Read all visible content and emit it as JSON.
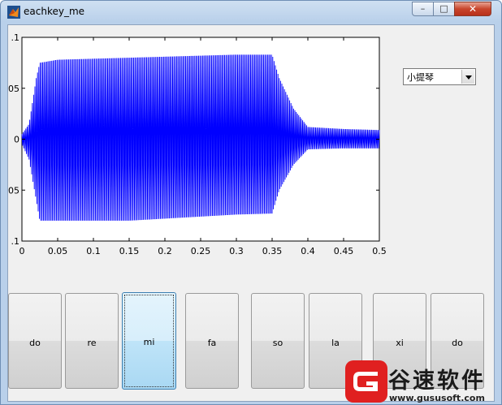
{
  "window": {
    "title": "eachkey_me",
    "min_label": "–",
    "max_label": "□",
    "close_label": "✕"
  },
  "axes": {
    "yticks": [
      {
        "value": 0.1,
        "label": ".1"
      },
      {
        "value": 0.05,
        "label": ".05"
      },
      {
        "value": 0,
        "label": "0"
      },
      {
        "value": -0.05,
        "label": ".05"
      },
      {
        "value": -0.1,
        "label": ".1"
      }
    ],
    "xticks": [
      {
        "value": 0,
        "label": "0"
      },
      {
        "value": 0.05,
        "label": "0.05"
      },
      {
        "value": 0.1,
        "label": "0.1"
      },
      {
        "value": 0.15,
        "label": "0.15"
      },
      {
        "value": 0.2,
        "label": "0.2"
      },
      {
        "value": 0.25,
        "label": "0.25"
      },
      {
        "value": 0.3,
        "label": "0.3"
      },
      {
        "value": 0.35,
        "label": "0.35"
      },
      {
        "value": 0.4,
        "label": "0.4"
      },
      {
        "value": 0.45,
        "label": "0.45"
      },
      {
        "value": 0.5,
        "label": "0.5"
      }
    ],
    "xlim": [
      0,
      0.5
    ],
    "ylim": [
      -0.1,
      0.1
    ],
    "line_color": "#0000ff"
  },
  "chart_data": {
    "type": "line",
    "title": "",
    "xlabel": "",
    "ylabel": "",
    "xlim": [
      0,
      0.5
    ],
    "ylim": [
      -0.1,
      0.1
    ],
    "grid": false,
    "series": [
      {
        "color": "#0000ff",
        "envelope_x": [
          0,
          0.01,
          0.02,
          0.025,
          0.05,
          0.1,
          0.15,
          0.2,
          0.25,
          0.3,
          0.35,
          0.36,
          0.38,
          0.4,
          0.45,
          0.5
        ],
        "envelope_upper": [
          0.005,
          0.015,
          0.06,
          0.075,
          0.078,
          0.079,
          0.08,
          0.081,
          0.082,
          0.083,
          0.083,
          0.06,
          0.03,
          0.012,
          0.01,
          0.009
        ],
        "envelope_lower": [
          -0.005,
          -0.02,
          -0.06,
          -0.08,
          -0.08,
          -0.08,
          -0.08,
          -0.078,
          -0.076,
          -0.074,
          -0.073,
          -0.05,
          -0.025,
          -0.01,
          -0.009,
          -0.009
        ]
      }
    ]
  },
  "instrument_select": {
    "value": "小提琴"
  },
  "keys": [
    {
      "label": "do",
      "active": false
    },
    {
      "label": "re",
      "active": false
    },
    {
      "label": "mi",
      "active": true
    },
    {
      "label": "fa",
      "active": false
    },
    {
      "label": "so",
      "active": false
    },
    {
      "label": "la",
      "active": false
    },
    {
      "label": "xi",
      "active": false
    },
    {
      "label": "do",
      "active": false
    }
  ],
  "watermark": {
    "brand": "谷速软件",
    "url": "www.gususoft.com",
    "color": "#e02020"
  }
}
